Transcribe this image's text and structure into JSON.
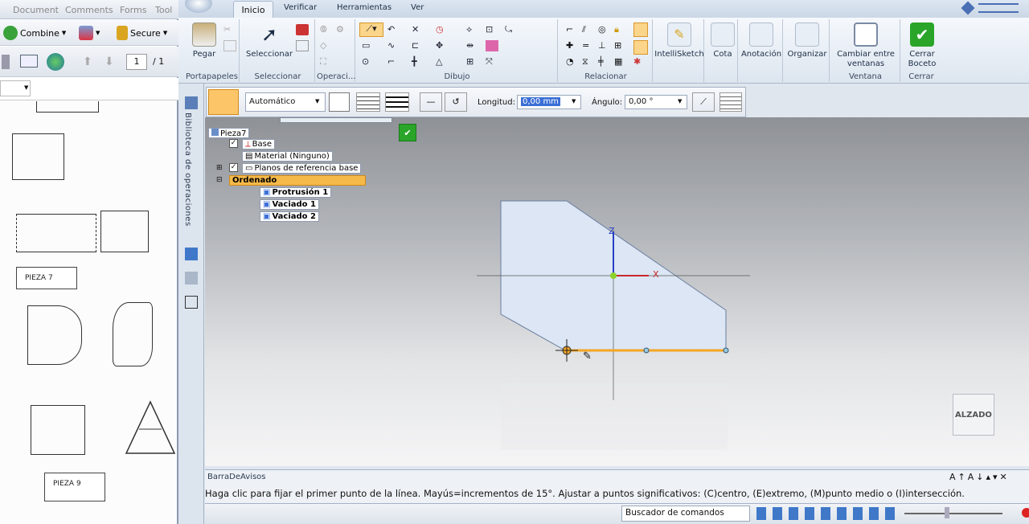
{
  "pdf": {
    "menu": [
      "Document",
      "Comments",
      "Forms",
      "Tool"
    ],
    "combine_label": "Combine",
    "secure_label": "Secure",
    "page_current": "1",
    "page_total": "/ 1",
    "sketch_labels": [
      "PIEZA 7",
      "PIEZA 9"
    ]
  },
  "solidedge": {
    "tabs": [
      "Inicio",
      "Verificar",
      "Herramientas",
      "Ver"
    ],
    "groups": {
      "portapapeles": "Portapapeles",
      "seleccionar": "Seleccionar",
      "operaci": "Operaci...",
      "dibujo": "Dibujo",
      "relacionar": "Relacionar",
      "ventana": "Ventana",
      "cerrar": "Cerrar"
    },
    "buttons": {
      "pegar": "Pegar",
      "seleccionar": "Seleccionar",
      "intellisketch": "IntelliSketch",
      "cota": "Cota",
      "anotacion": "Anotación",
      "organizar": "Organizar",
      "cambiar_ventanas": "Cambiar entre ventanas",
      "cerrar_boceto": "Cerrar Boceto"
    },
    "cmdbar": {
      "style_value": "Automático",
      "longitud_label": "Longitud:",
      "longitud_value": "0,00 mm",
      "angulo_label": "Ángulo:",
      "angulo_value": "0,00 °"
    },
    "vertical_tab": "Biblioteca de operaciones",
    "tree": {
      "root": "Pieza7",
      "base": "Base",
      "material": "Material (Ninguno)",
      "planos": "Planos de referencia base",
      "ordenado": "Ordenado",
      "features": [
        "Protrusión 1",
        "Vaciado 1",
        "Vaciado 2"
      ]
    },
    "axes": {
      "z": "Z",
      "x": "X"
    },
    "view_label": "ALZADO",
    "notice_title": "BarraDeAvisos",
    "notice_text": "Haga clic para fijar el primer punto de la línea. Mayús=incrementos de 15°. Ajustar a puntos significativos: (C)centro, (E)extremo, (M)punto medio o (I)intersección.",
    "command_finder": "Buscador de comandos",
    "colors": {
      "accent": "#f5a623",
      "ribbon": "#dde6f0",
      "canvas_top": "#8e9196",
      "shape_fill": "#dce6f4",
      "close_green": "#2aa52a"
    }
  }
}
